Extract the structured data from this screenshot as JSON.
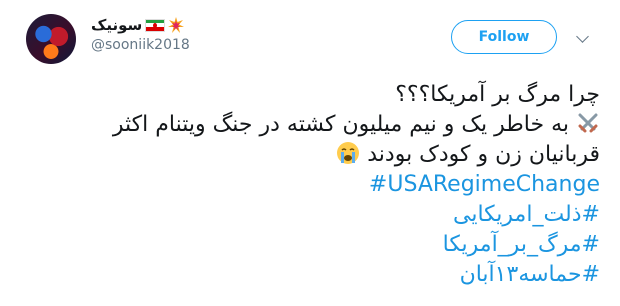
{
  "user": {
    "display_name": "سونیک",
    "handle": "@sooniik2018"
  },
  "follow_button": {
    "label": "Follow"
  },
  "icons": [
    "avatar",
    "iran-flag-icon",
    "collision-icon",
    "crossed-swords-icon",
    "crying-face-icon",
    "chevron-down-icon"
  ],
  "tweet": {
    "line1": "چرا مرگ بر آمریکا؟؟؟",
    "line2": "به خاطر یک و نیم میلیون کشته  در جنگ ویتنام اکثر",
    "line3": "قربانیان زن و کودک بودند",
    "hashtags": [
      "#USARegimeChange",
      "#ذلت_امریکایی",
      "#مرگ_بر_آمریکا",
      "#حماسه۱۳آبان"
    ]
  },
  "colors": {
    "accent": "#1da1f2",
    "link": "#1b95e0",
    "muted": "#657786",
    "text": "#14171a"
  }
}
